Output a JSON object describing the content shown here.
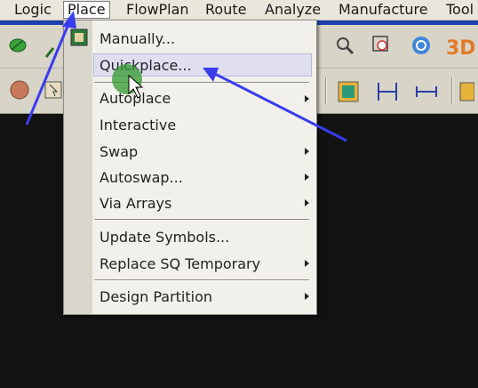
{
  "menubar": {
    "items": [
      {
        "id": "logic",
        "label": "Logic"
      },
      {
        "id": "place",
        "label": "Place"
      },
      {
        "id": "flowplan",
        "label": "FlowPlan"
      },
      {
        "id": "route",
        "label": "Route"
      },
      {
        "id": "analyze",
        "label": "Analyze"
      },
      {
        "id": "manufacture",
        "label": "Manufacture"
      },
      {
        "id": "tools",
        "label": "Tool"
      }
    ]
  },
  "place_menu": {
    "items": [
      {
        "label": "Manually...",
        "submenu": false
      },
      {
        "label": "Quickplace...",
        "submenu": false,
        "highlighted": true
      },
      {
        "label": "Autoplace",
        "submenu": true
      },
      {
        "label": "Interactive",
        "submenu": false
      },
      {
        "label": "Swap",
        "submenu": true
      },
      {
        "label": "Autoswap...",
        "submenu": true
      },
      {
        "label": "Via Arrays",
        "submenu": true
      },
      {
        "label": "Update Symbols...",
        "submenu": false
      },
      {
        "label": "Replace SQ Temporary",
        "submenu": true
      },
      {
        "label": "Design Partition",
        "submenu": true
      }
    ]
  },
  "toolbar_icons": [
    "leaf-icon",
    "zoom-icon",
    "zoom-fit-icon",
    "refresh-icon",
    "3d-view-icon",
    "circle-icon",
    "select-icon",
    "component-icon",
    "dimension-icon",
    "measure-icon"
  ],
  "colors": {
    "accent": "#1f3fae",
    "annotation_arrow": "#3a3cf0",
    "cursor_highlight": "#2e9a2e"
  }
}
